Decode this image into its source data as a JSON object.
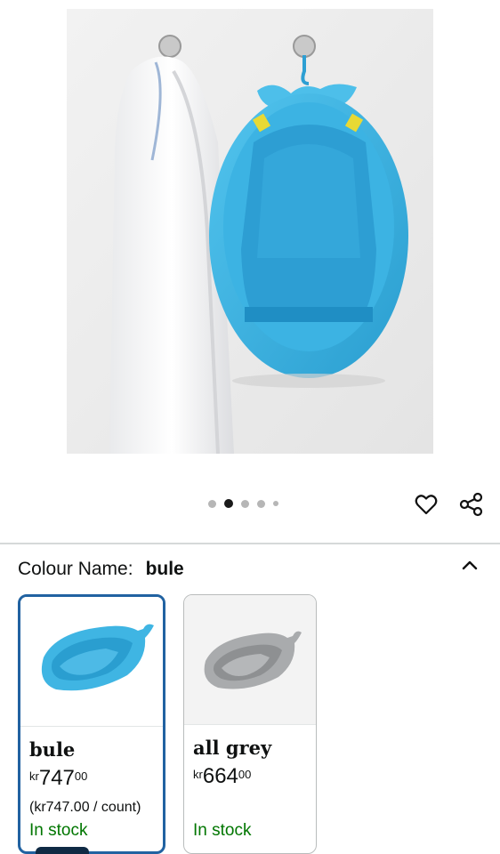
{
  "product": {
    "image_icon": "product-photo-baby-bath-tub",
    "carousel": {
      "count": 5,
      "active_index": 1
    },
    "actions": {
      "favorite_icon": "heart-icon",
      "share_icon": "share-icon"
    }
  },
  "variation": {
    "label": "Colour Name:",
    "selected_value": "bule",
    "collapse_icon": "chevron-up-icon",
    "options": [
      {
        "name": "bule",
        "price_currency": "kr",
        "price_whole": "747",
        "price_fraction": "00",
        "unit_price": "(kr747.00 / count)",
        "stock": "In stock",
        "selected": true,
        "color": "#3fb5e3"
      },
      {
        "name": "all grey",
        "price_currency": "kr",
        "price_whole": "664",
        "price_fraction": "00",
        "unit_price": "",
        "stock": "In stock",
        "selected": false,
        "color": "#a9abad"
      }
    ]
  },
  "colors": {
    "accent_border": "#2162a1",
    "in_stock": "#007600"
  }
}
